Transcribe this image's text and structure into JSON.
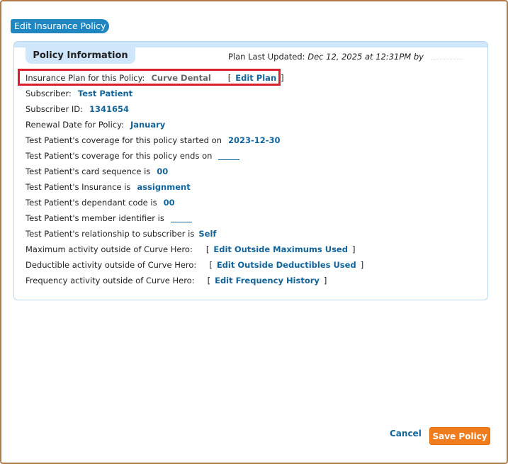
{
  "dialog": {
    "title": "Edit Insurance Policy"
  },
  "panel": {
    "tab_label": "Policy Information",
    "last_updated_label": "Plan Last Updated:",
    "last_updated_value": "Dec 12, 2025 at 12:31PM by"
  },
  "fields": {
    "plan_label": "Insurance Plan for this Policy:",
    "plan_value": "Curve Dental",
    "edit_plan": "Edit Plan",
    "subscriber_label": "Subscriber:",
    "subscriber_value": "Test Patient",
    "subscriber_id_label": "Subscriber ID:",
    "subscriber_id_value": "1341654",
    "renewal_label": "Renewal Date for Policy:",
    "renewal_value": "January",
    "coverage_start_label": "Test Patient's coverage for this policy started on",
    "coverage_start_value": "2023-12-30",
    "coverage_end_label": "Test Patient's coverage for this policy ends on",
    "card_seq_label": "Test Patient's card sequence is",
    "card_seq_value": "00",
    "insurance_label": "Test Patient's Insurance is",
    "insurance_value": "assignment",
    "dependant_label": "Test Patient's dependant code is",
    "dependant_value": "00",
    "member_id_label": "Test Patient's member identifier is",
    "relationship_label": "Test Patient's relationship to subscriber is",
    "relationship_value": "Self",
    "max_activity_label": "Maximum activity outside of Curve Hero:",
    "max_activity_link": "Edit Outside Maximums Used",
    "deductible_label": "Deductible activity outside of Curve Hero:",
    "deductible_link": "Edit Outside Deductibles Used",
    "frequency_label": "Frequency activity outside of Curve Hero:",
    "frequency_link": "Edit Frequency History"
  },
  "footer": {
    "cancel": "Cancel",
    "save": "Save Policy"
  },
  "colors": {
    "accent_blue": "#12649a",
    "title_blue": "#1f86c0",
    "save_orange": "#f07c1d",
    "highlight_red": "#d9202b"
  }
}
